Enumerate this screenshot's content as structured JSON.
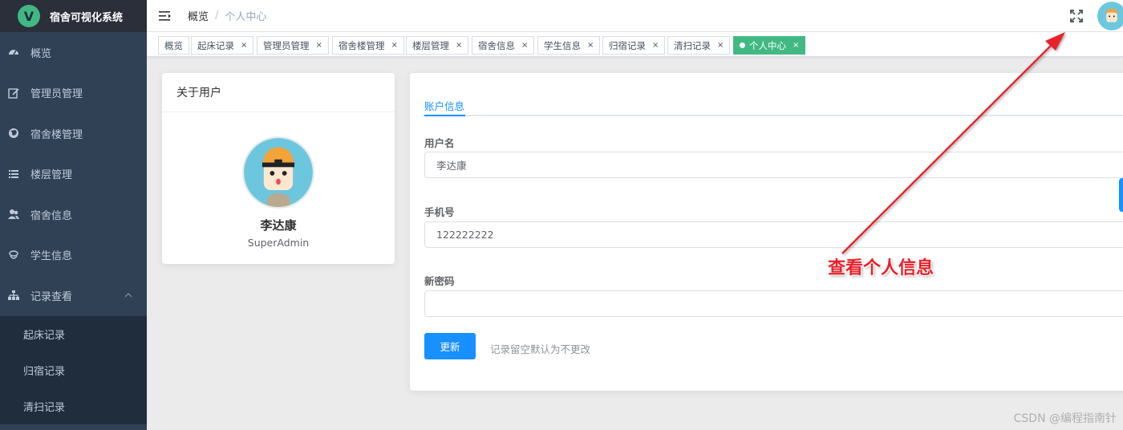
{
  "app": {
    "title": "宿舍可视化系统",
    "logo_letter": "V"
  },
  "sidebar": {
    "items": [
      {
        "label": "概览",
        "icon": "dashboard-icon"
      },
      {
        "label": "管理员管理",
        "icon": "edit-icon"
      },
      {
        "label": "宿舍楼管理",
        "icon": "globe-icon"
      },
      {
        "label": "楼层管理",
        "icon": "list-icon"
      },
      {
        "label": "宿舍信息",
        "icon": "peoples-icon"
      },
      {
        "label": "学生信息",
        "icon": "student-icon"
      },
      {
        "label": "记录查看",
        "icon": "tree-icon"
      }
    ],
    "subitems": [
      {
        "label": "起床记录"
      },
      {
        "label": "归宿记录"
      },
      {
        "label": "清扫记录"
      }
    ]
  },
  "header": {
    "breadcrumb_home": "概览",
    "breadcrumb_sep": "/",
    "breadcrumb_current": "个人中心"
  },
  "tags": [
    {
      "label": "概览",
      "closable": false
    },
    {
      "label": "起床记录",
      "closable": true
    },
    {
      "label": "管理员管理",
      "closable": true
    },
    {
      "label": "宿舍楼管理",
      "closable": true
    },
    {
      "label": "楼层管理",
      "closable": true
    },
    {
      "label": "宿舍信息",
      "closable": true
    },
    {
      "label": "学生信息",
      "closable": true
    },
    {
      "label": "归宿记录",
      "closable": true
    },
    {
      "label": "清扫记录",
      "closable": true
    },
    {
      "label": "个人中心",
      "closable": true,
      "active": true
    }
  ],
  "tag_close_glyph": "×",
  "profile": {
    "card_title": "关于用户",
    "name": "李达康",
    "role": "SuperAdmin"
  },
  "account": {
    "tab_label": "账户信息",
    "username_label": "用户名",
    "username_value": "李达康",
    "phone_label": "手机号",
    "phone_value": "122222222",
    "password_label": "新密码",
    "password_value": "",
    "update_button": "更新",
    "hint": "记录留空默认为不更改"
  },
  "annotation": {
    "text": "查看个人信息",
    "color": "#e8202a"
  },
  "watermark": "CSDN @编程指南针",
  "colors": {
    "sidebar_bg": "#304156",
    "sidebar_text": "#bfcbd9",
    "active_tag": "#42b983",
    "primary": "#1890ff"
  }
}
